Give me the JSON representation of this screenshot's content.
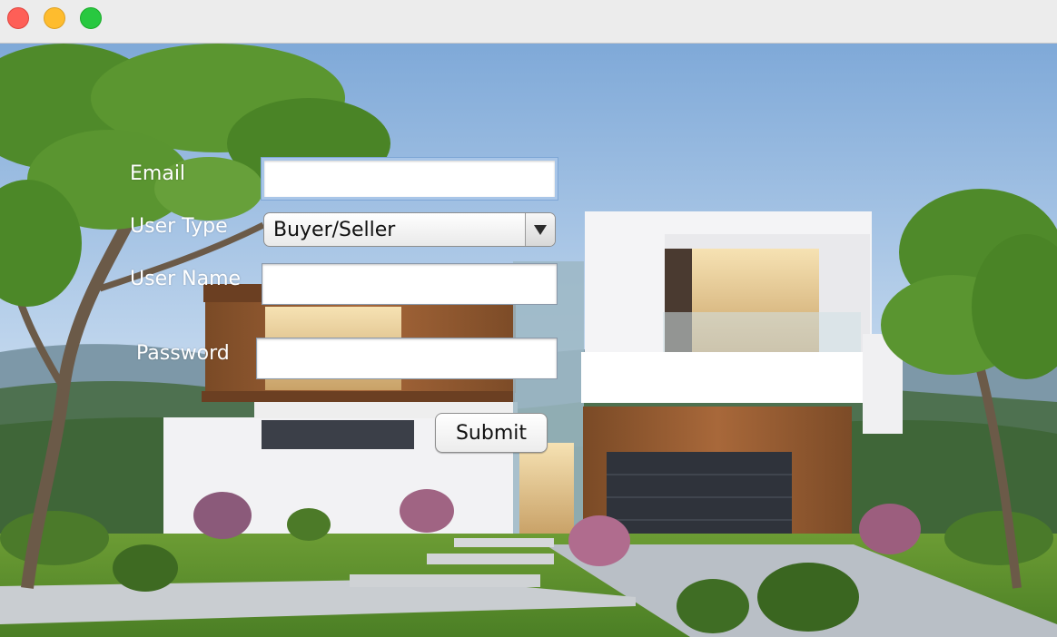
{
  "window": {
    "controls": [
      "close",
      "minimize",
      "maximize"
    ]
  },
  "form": {
    "email_label": "Email",
    "email_value": "",
    "user_type_label": "User Type",
    "user_type_selected": "Buyer/Seller",
    "user_name_label": "User Name",
    "user_name_value": "",
    "password_label": "Password",
    "password_value": "",
    "submit_label": "Submit"
  },
  "background": {
    "description_icon": "modern-house-photo",
    "sky_color": "#8fb6e0",
    "lawn_color": "#5a8f2e"
  },
  "colors": {
    "focus_ring": "#a9c6e8",
    "label_text": "#ffffff"
  }
}
